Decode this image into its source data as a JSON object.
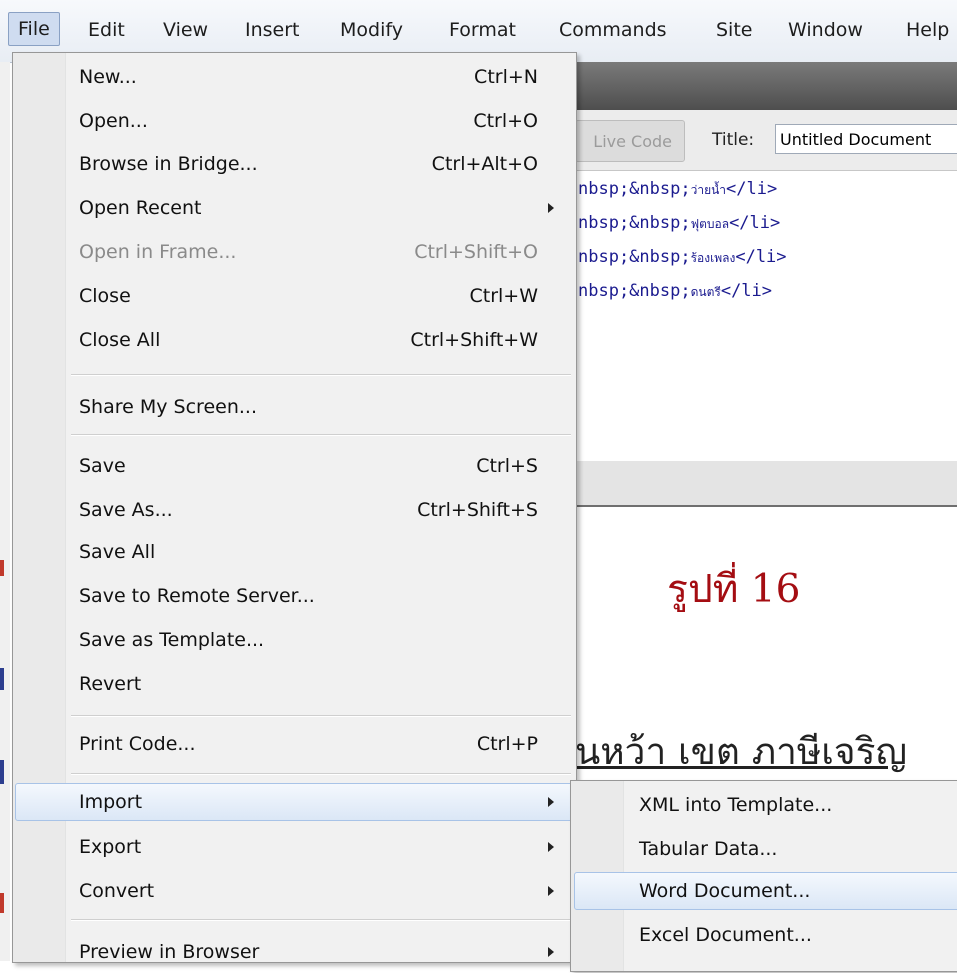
{
  "menubar": {
    "items": [
      "File",
      "Edit",
      "View",
      "Insert",
      "Modify",
      "Format",
      "Commands",
      "Site",
      "Window",
      "Help"
    ]
  },
  "toolbar": {
    "live_code_label": "Live Code",
    "title_label": "Title:",
    "title_value": "Untitled Document"
  },
  "code": {
    "lines": [
      {
        "prefix": "nbsp;&nbsp;",
        "thai": "ว่ายน้ำ",
        "tag": "</li>"
      },
      {
        "prefix": "nbsp;&nbsp;",
        "thai": "ฟุตบอล",
        "tag": "</li>"
      },
      {
        "prefix": "nbsp;&nbsp;",
        "thai": "ร้องเพลง",
        "tag": "</li>"
      },
      {
        "prefix": "nbsp;&nbsp;",
        "thai": "ดนตรี",
        "tag": "</li>"
      }
    ]
  },
  "design": {
    "caption": "รูปที่ 16",
    "heading_fragment": "นหว้า เขต ภาษีเจริญ"
  },
  "file_menu": {
    "items": [
      {
        "label": "New...",
        "shortcut": "Ctrl+N"
      },
      {
        "label": "Open...",
        "shortcut": "Ctrl+O"
      },
      {
        "label": "Browse in Bridge...",
        "shortcut": "Ctrl+Alt+O"
      },
      {
        "label": "Open Recent",
        "shortcut": ""
      },
      {
        "label": "Open in Frame...",
        "shortcut": "Ctrl+Shift+O"
      },
      {
        "label": "Close",
        "shortcut": "Ctrl+W"
      },
      {
        "label": "Close All",
        "shortcut": "Ctrl+Shift+W"
      },
      {
        "label": "Share My Screen...",
        "shortcut": ""
      },
      {
        "label": "Save",
        "shortcut": "Ctrl+S"
      },
      {
        "label": "Save As...",
        "shortcut": "Ctrl+Shift+S"
      },
      {
        "label": "Save All",
        "shortcut": ""
      },
      {
        "label": "Save to Remote Server...",
        "shortcut": ""
      },
      {
        "label": "Save as Template...",
        "shortcut": ""
      },
      {
        "label": "Revert",
        "shortcut": ""
      },
      {
        "label": "Print Code...",
        "shortcut": "Ctrl+P"
      },
      {
        "label": "Import",
        "shortcut": ""
      },
      {
        "label": "Export",
        "shortcut": ""
      },
      {
        "label": "Convert",
        "shortcut": ""
      },
      {
        "label": "Preview in Browser",
        "shortcut": ""
      }
    ]
  },
  "import_submenu": {
    "items": [
      {
        "label": "XML into Template..."
      },
      {
        "label": "Tabular Data..."
      },
      {
        "label": "Word Document..."
      },
      {
        "label": "Excel Document..."
      }
    ]
  },
  "colors": {
    "highlight_border": "#a8c3e7",
    "caption_red": "#a40d12",
    "code_blue": "#1b1b8f"
  }
}
